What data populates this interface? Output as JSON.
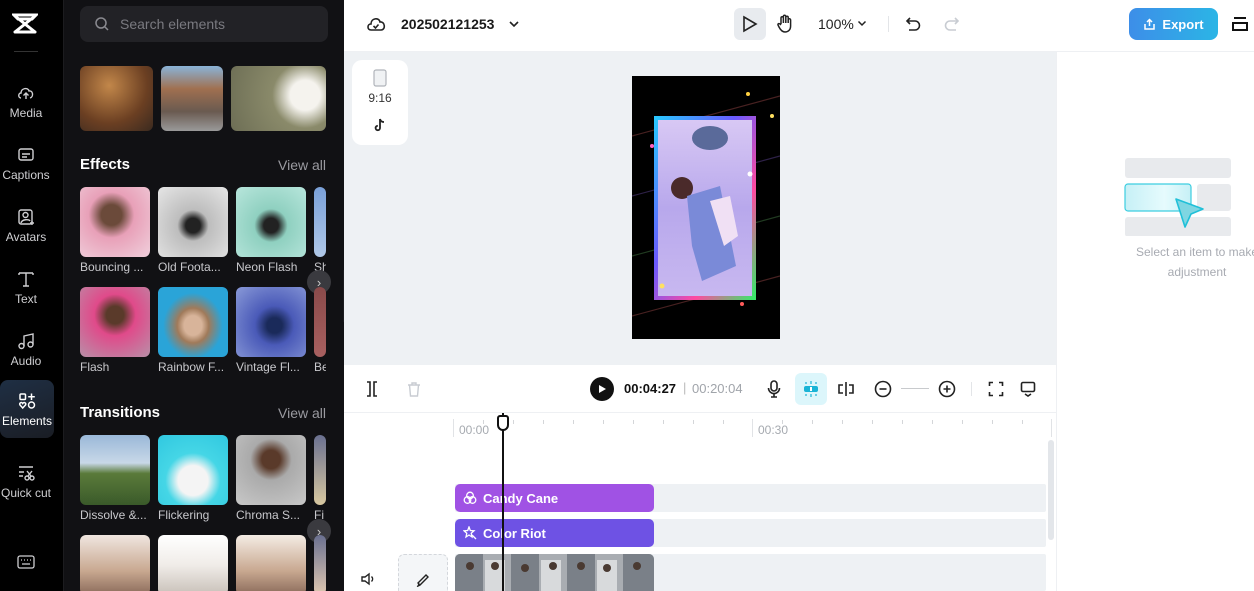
{
  "rail": {
    "items": [
      {
        "label": "Media",
        "icon": "cloud-upload-icon"
      },
      {
        "label": "Captions",
        "icon": "captions-icon"
      },
      {
        "label": "Avatars",
        "icon": "avatar-icon"
      },
      {
        "label": "Text",
        "icon": "text-icon"
      },
      {
        "label": "Audio",
        "icon": "music-note-icon"
      },
      {
        "label": "Elements",
        "icon": "elements-icon",
        "active": true
      },
      {
        "label": "Quick cut",
        "icon": "scissors-icon"
      }
    ]
  },
  "panel": {
    "search_placeholder": "Search elements",
    "effects": {
      "title": "Effects",
      "view_all": "View all",
      "row1": [
        "Bouncing ...",
        "Old Foota...",
        "Neon Flash",
        "Sh"
      ],
      "row2": [
        "Flash",
        "Rainbow F...",
        "Vintage Fl...",
        "Be"
      ]
    },
    "transitions": {
      "title": "Transitions",
      "view_all": "View all",
      "row1": [
        "Dissolve &...",
        "Flickering",
        "Chroma S...",
        "Fi"
      ]
    }
  },
  "topbar": {
    "project_title": "202502121253",
    "zoom_level": "100%",
    "export_label": "Export"
  },
  "canvas": {
    "aspect_ratio": "9:16",
    "platform_icon": "tiktok-icon"
  },
  "right_panel": {
    "hint": "Select an item to make adjustment"
  },
  "playback": {
    "current_time": "00:04:27",
    "separator": "|",
    "total_time": "00:20:04"
  },
  "timeline": {
    "ruler": [
      "00:00",
      "00:30"
    ],
    "clips": [
      {
        "label": "Candy Cane",
        "color": "#a052e4",
        "icon": "filter-circles-icon"
      },
      {
        "label": "Color Riot",
        "color": "#6e52e4",
        "icon": "magic-star-icon"
      }
    ]
  },
  "colors": {
    "accent": "#2bb5e6",
    "rail_bg": "#000000",
    "panel_bg": "#111114"
  }
}
